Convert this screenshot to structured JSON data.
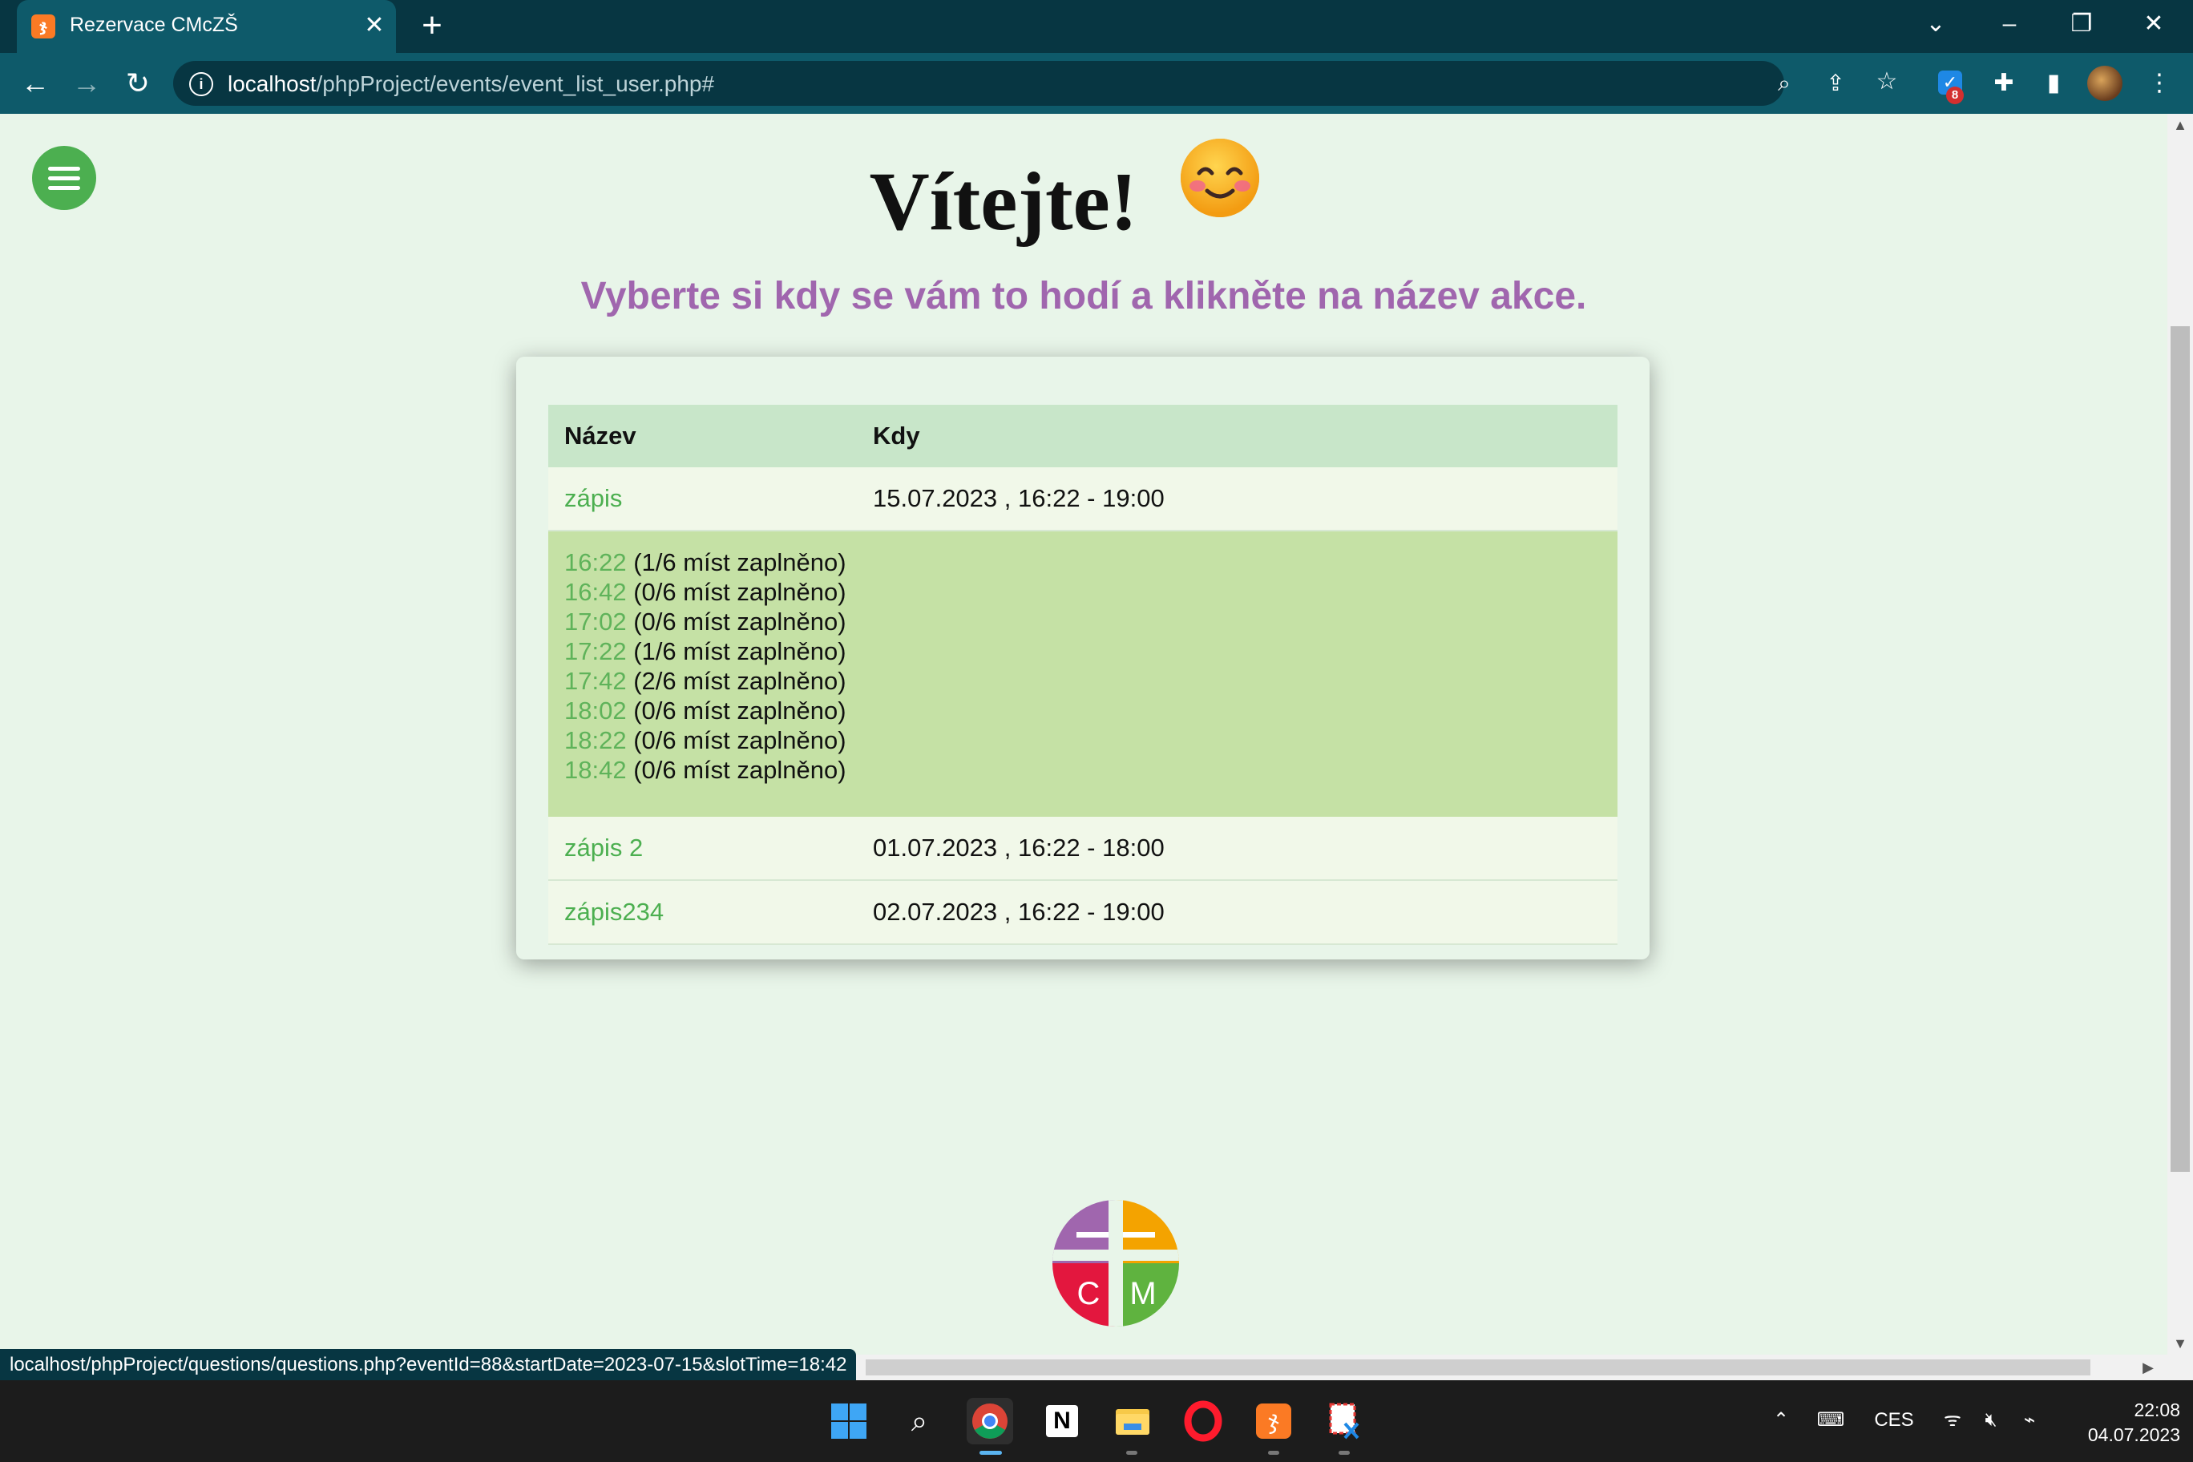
{
  "browser": {
    "tab_title": "Rezervace CMcZŠ",
    "tab_close": "✕",
    "new_tab": "+",
    "url_host": "localhost",
    "url_path": "/phpProject/events/event_list_user.php#",
    "extension_badge": "8"
  },
  "page": {
    "welcome": "Vítejte!",
    "subtitle": "Vyberte si kdy se vám to hodí a klikněte na název akce.",
    "table_headers": {
      "name": "Název",
      "when": "Kdy"
    },
    "events": [
      {
        "name": "zápis",
        "date": "15.07.2023 , 16:22 - 19:00"
      },
      {
        "name": "zápis 2",
        "date": "01.07.2023 , 16:22 - 18:00"
      },
      {
        "name": "zápis234",
        "date": "02.07.2023 , 16:22 - 19:00"
      }
    ],
    "slots": [
      {
        "time": "16:22",
        "info": " (1/6 míst zaplněno)"
      },
      {
        "time": "16:42",
        "info": " (0/6 míst zaplněno)"
      },
      {
        "time": "17:02",
        "info": " (0/6 míst zaplněno)"
      },
      {
        "time": "17:22",
        "info": " (1/6 míst zaplněno)"
      },
      {
        "time": "17:42",
        "info": " (2/6 míst zaplněno)"
      },
      {
        "time": "18:02",
        "info": " (0/6 míst zaplněno)"
      },
      {
        "time": "18:22",
        "info": " (0/6 míst zaplněno)"
      },
      {
        "time": "18:42",
        "info": " (0/6 míst zaplněno)"
      }
    ],
    "logo_letters": {
      "left": "C",
      "right": "M"
    }
  },
  "status_bar": "localhost/phpProject/questions/questions.php?eventId=88&startDate=2023-07-15&slotTime=18:42",
  "taskbar": {
    "language": "CES",
    "time": "22:08",
    "date": "04.07.2023"
  },
  "colors": {
    "chrome_dark": "#073642",
    "chrome_toolbar": "#0e5a6a",
    "page_bg": "#e8f5e9",
    "header_row": "#c8e6c9",
    "slots_bg": "#c5e1a5",
    "link_green": "#4caf50",
    "subtitle_purple": "#a066ae"
  }
}
